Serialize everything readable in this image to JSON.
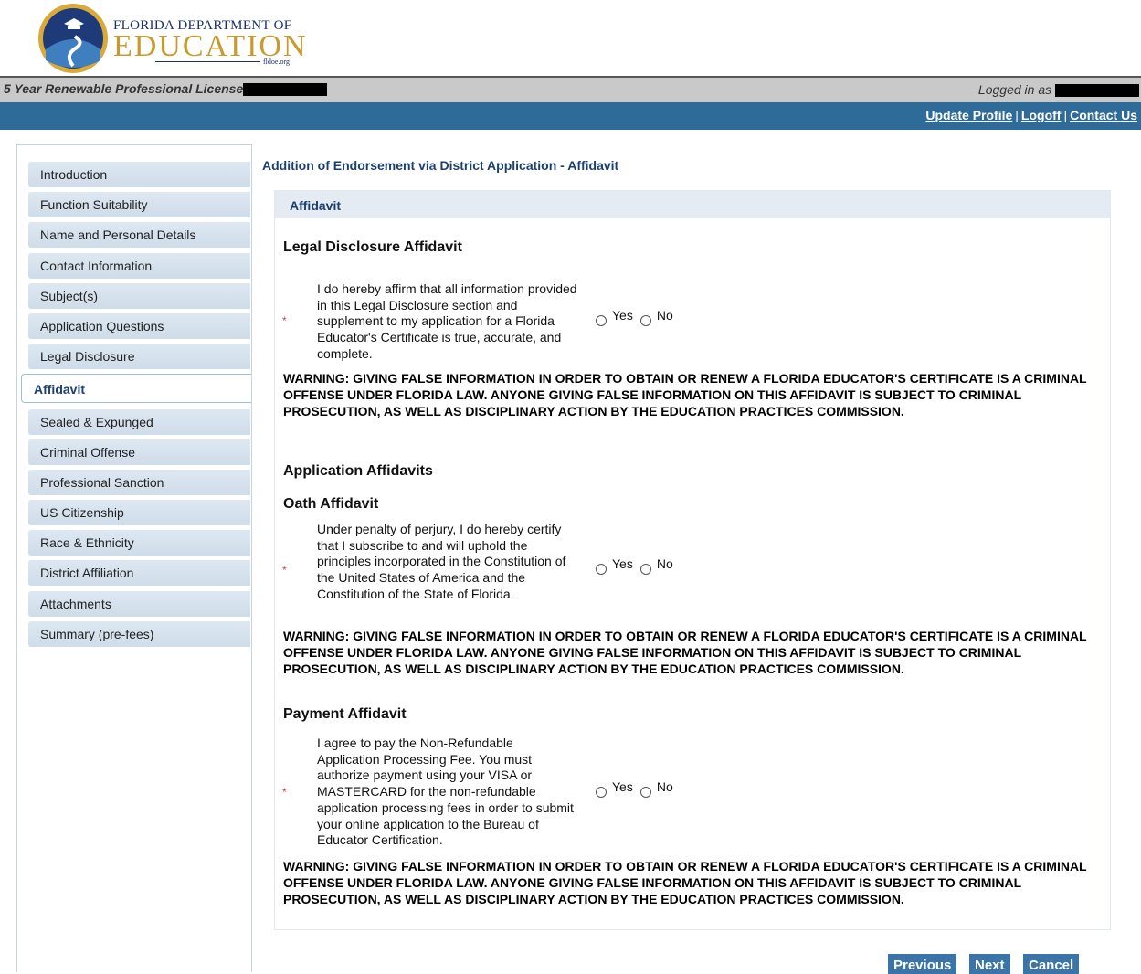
{
  "header": {
    "logo_line1": "FLORIDA DEPARTMENT OF",
    "logo_line2": "EDUCATION",
    "logo_line3": "fldoe.org",
    "license_title": "5 Year Renewable Professional License",
    "logged_in_label": "Logged in as",
    "links": {
      "update_profile": "Update Profile",
      "logoff": "Logoff",
      "contact_us": "Contact Us",
      "separator": "|"
    }
  },
  "sidebar": {
    "items": [
      {
        "label": "Introduction"
      },
      {
        "label": "Function Suitability"
      },
      {
        "label": "Name and Personal Details"
      },
      {
        "label": "Contact Information"
      },
      {
        "label": "Subject(s)"
      },
      {
        "label": "Application Questions"
      },
      {
        "label": "Legal Disclosure"
      },
      {
        "label": "Affidavit",
        "active": true
      },
      {
        "label": "Sealed & Expunged"
      },
      {
        "label": "Criminal Offense"
      },
      {
        "label": "Professional Sanction"
      },
      {
        "label": "US Citizenship"
      },
      {
        "label": "Race & Ethnicity"
      },
      {
        "label": "District Affiliation"
      },
      {
        "label": "Attachments"
      },
      {
        "label": "Summary (pre-fees)"
      }
    ]
  },
  "main": {
    "page_heading": "Addition of Endorsement via District Application - Affidavit",
    "panel_title": "Affidavit",
    "required_marker": "*",
    "warning_text": "WARNING: GIVING FALSE INFORMATION IN ORDER TO OBTAIN OR RENEW A FLORIDA EDUCATOR'S CERTIFICATE IS A CRIMINAL OFFENSE UNDER FLORIDA LAW. ANYONE GIVING FALSE INFORMATION ON THIS AFFIDAVIT IS SUBJECT TO CRIMINAL PROSECUTION, AS WELL AS DISCIPLINARY ACTION BY THE EDUCATION PRACTICES COMMISSION.",
    "yes_label": "Yes",
    "no_label": "No",
    "legal": {
      "heading": "Legal Disclosure Affidavit",
      "question": "I do hereby affirm that all information provided in this Legal Disclosure section and supplement to my application for a Florida Educator's Certificate is true, accurate, and complete."
    },
    "app_affidavits_heading": "Application Affidavits",
    "oath": {
      "heading": "Oath Affidavit",
      "question": "Under penalty of perjury, I do hereby certify that I subscribe to and will uphold the principles incorporated in the Constitution of the United States of America and the Constitution of the State of Florida."
    },
    "payment": {
      "heading": "Payment Affidavit",
      "question": "I agree to pay the Non-Refundable Application Processing Fee. You must authorize payment using your VISA or MASTERCARD for the non-refundable application processing fees in order to submit your online application to the Bureau of Educator Certification."
    }
  },
  "buttons": {
    "previous": "Previous",
    "next": "Next",
    "cancel": "Cancel"
  }
}
